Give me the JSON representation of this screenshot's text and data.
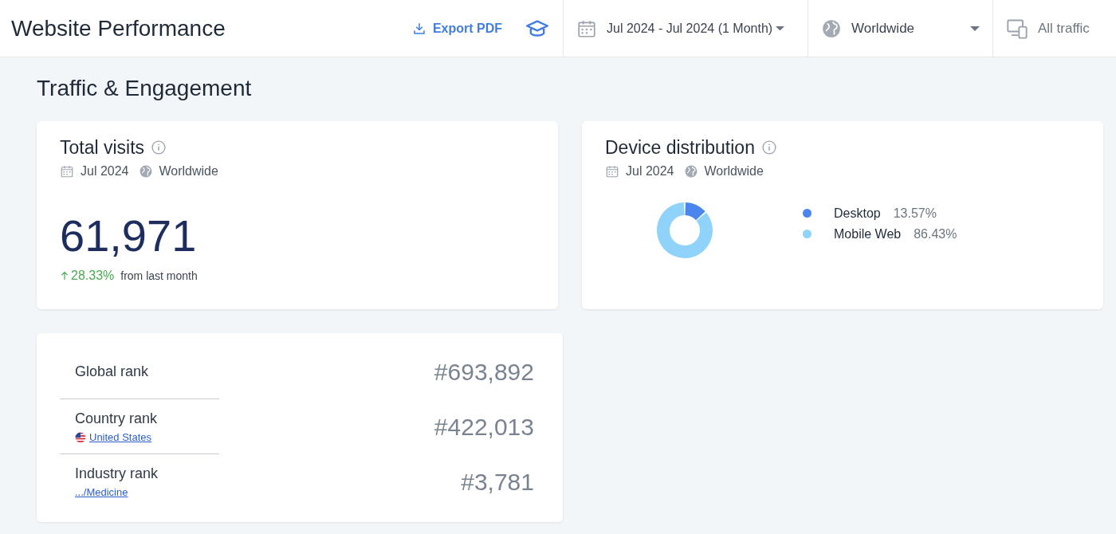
{
  "header": {
    "title": "Website Performance",
    "export_label": "Export PDF",
    "date_range": "Jul 2024 - Jul 2024 (1 Month)",
    "region": "Worldwide",
    "traffic": "All traffic"
  },
  "section_title": "Traffic & Engagement",
  "total_visits": {
    "title": "Total visits",
    "date": "Jul 2024",
    "region": "Worldwide",
    "value": "61,971",
    "change": "28.33%",
    "change_note": "from last month"
  },
  "device_distribution": {
    "title": "Device distribution",
    "date": "Jul 2024",
    "region": "Worldwide",
    "chart_data": {
      "type": "donut",
      "categories": [
        "Desktop",
        "Mobile Web"
      ],
      "values": [
        13.57,
        86.43
      ],
      "legend": true,
      "colors": [
        "#4a86ee",
        "#8fd3fb"
      ],
      "value_labels": [
        "13.57%",
        "86.43%"
      ]
    }
  },
  "ranks": [
    {
      "label": "Global rank",
      "flag": false,
      "value": "#693,892"
    },
    {
      "label": "Country rank",
      "flag": true,
      "link": "United States",
      "value": "#422,013"
    },
    {
      "label": "Industry rank",
      "flag": false,
      "link": ".../Medicine",
      "value": "#3,781"
    }
  ]
}
